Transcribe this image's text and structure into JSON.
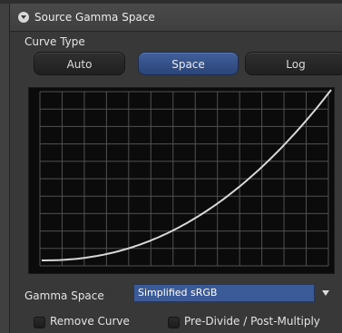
{
  "header": {
    "title": "Source Gamma Space",
    "collapse_icon": "chevron-down-icon"
  },
  "curve_type": {
    "label": "Curve Type",
    "options": [
      {
        "label": "Auto",
        "selected": false
      },
      {
        "label": "Space",
        "selected": true
      },
      {
        "label": "Log",
        "selected": false
      }
    ]
  },
  "gamma_space": {
    "label": "Gamma Space",
    "value": "Simplified sRGB"
  },
  "options": {
    "remove_curve": {
      "label": "Remove Curve",
      "checked": false
    },
    "pre_divide": {
      "label": "Pre-Divide / Post-Multiply",
      "checked": false
    }
  },
  "colors": {
    "accent": "#3b5a98",
    "panel": "#383838",
    "curve": "#d8d8d8",
    "grid": "#505050"
  }
}
